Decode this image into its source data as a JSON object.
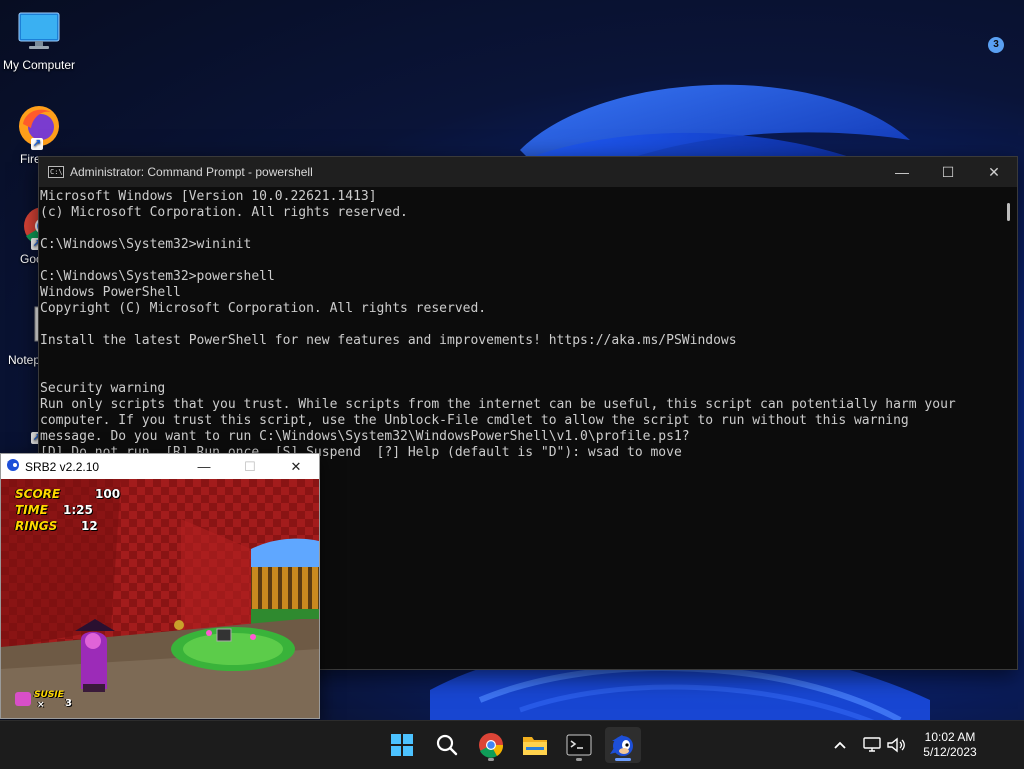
{
  "desktop": {
    "icons": [
      {
        "label": "My Computer"
      },
      {
        "label": "Fire"
      },
      {
        "label": "Goo Chr"
      },
      {
        "label": "Notep"
      },
      {
        "label": ""
      }
    ]
  },
  "cmd": {
    "title": "Administrator: Command Prompt - powershell",
    "lines": [
      "Microsoft Windows [Version 10.0.22621.1413]",
      "(c) Microsoft Corporation. All rights reserved.",
      "",
      "C:\\Windows\\System32>wininit",
      "",
      "C:\\Windows\\System32>powershell",
      "Windows PowerShell",
      "Copyright (C) Microsoft Corporation. All rights reserved.",
      "",
      "Install the latest PowerShell for new features and improvements! https://aka.ms/PSWindows",
      "",
      "",
      "Security warning",
      "Run only scripts that you trust. While scripts from the internet can be useful, this script can potentially harm your",
      "computer. If you trust this script, use the Unblock-File cmdlet to allow the script to run without this warning",
      "message. Do you want to run C:\\Windows\\System32\\WindowsPowerShell\\v1.0\\profile.ps1?",
      "[D] Do not run  [R] Run once  [S] Suspend  [?] Help (default is \"D\"): wsad to move"
    ],
    "controls": {
      "minimize": "—",
      "maximize": "☐",
      "close": "✕"
    }
  },
  "srb2": {
    "title": "SRB2 v2.2.10",
    "hud": {
      "score_label": "SCORE",
      "score_value": "100",
      "time_label": "TIME",
      "time_value": "1:25",
      "rings_label": "RINGS",
      "rings_value": "12",
      "character": "SUSIE",
      "lives_x": "×",
      "lives": "3"
    },
    "controls": {
      "minimize": "—",
      "maximize": "☐",
      "close": "✕"
    }
  },
  "taskbar": {
    "apps": [
      "start-icon",
      "search-icon",
      "chrome-icon",
      "file-explorer-icon",
      "terminal-icon",
      "srb2-icon"
    ],
    "clock_time": "10:02 AM",
    "clock_date": "5/12/2023",
    "notification_count": "3"
  },
  "colors": {
    "console_bg": "#0c0c0c",
    "console_text": "#cccccc",
    "taskbar_bg": "#1c1c1c",
    "hud_yellow": "#ffd800",
    "accent": "#6c9dff"
  }
}
